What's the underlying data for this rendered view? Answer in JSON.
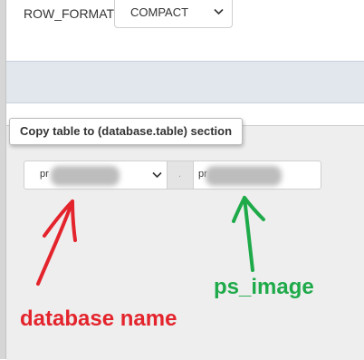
{
  "row_format": {
    "label": "ROW_FORMAT",
    "selected": "COMPACT"
  },
  "copy_section": {
    "title": "Copy table to (database.table) section",
    "database_select_value": "pr",
    "separator": ".",
    "table_input_value": "pr"
  },
  "annotations": {
    "table_label": "ps_image",
    "database_label": "database name",
    "red_color": "#e4242c",
    "green_color": "#1faa4a"
  }
}
